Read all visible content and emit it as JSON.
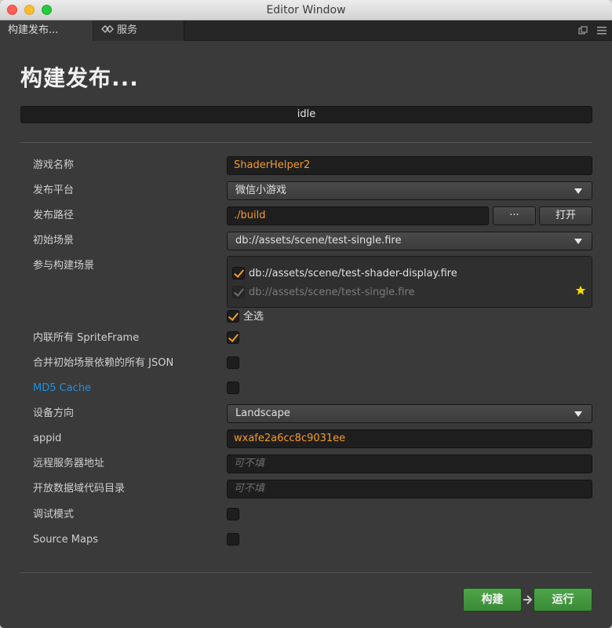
{
  "window": {
    "title": "Editor Window"
  },
  "tabs": [
    {
      "label": "构建发布..."
    },
    {
      "label": "服务",
      "icon": "services-icon"
    }
  ],
  "header": {
    "title": "构建发布..."
  },
  "status": {
    "text": "idle"
  },
  "form": {
    "game_name": {
      "label": "游戏名称",
      "value": "ShaderHelper2"
    },
    "platform": {
      "label": "发布平台",
      "value": "微信小游戏"
    },
    "build_path": {
      "label": "发布路径",
      "value": "./build",
      "browse_label": "···",
      "open_label": "打开"
    },
    "start_scene": {
      "label": "初始场景",
      "value": "db://assets/scene/test-single.fire"
    },
    "build_scenes": {
      "label": "参与构建场景",
      "items": [
        {
          "path": "db://assets/scene/test-shader-display.fire",
          "checked": true,
          "disabled": false
        },
        {
          "path": "db://assets/scene/test-single.fire",
          "checked": true,
          "disabled": true,
          "start_scene_icon": "star-icon"
        }
      ],
      "select_all_label": "全选",
      "select_all_checked": true
    },
    "inline_spriteframe": {
      "label": "内联所有 SpriteFrame",
      "checked": true
    },
    "merge_json": {
      "label": "合并初始场景依赖的所有 JSON",
      "checked": false
    },
    "md5_cache": {
      "label": "MD5 Cache",
      "checked": false
    },
    "orientation": {
      "label": "设备方向",
      "value": "Landscape"
    },
    "appid": {
      "label": "appid",
      "value": "wxafe2a6cc8c9031ee"
    },
    "remote_server": {
      "label": "远程服务器地址",
      "placeholder": "可不填"
    },
    "open_data_dir": {
      "label": "开放数据域代码目录",
      "placeholder": "可不填"
    },
    "debug_mode": {
      "label": "调试模式",
      "checked": false
    },
    "source_maps": {
      "label": "Source Maps",
      "checked": false
    }
  },
  "actions": {
    "build_label": "构建",
    "run_label": "运行"
  },
  "colors": {
    "accent": "#f39c2f",
    "link": "#1e8fe0",
    "action_green": "#44993f"
  }
}
